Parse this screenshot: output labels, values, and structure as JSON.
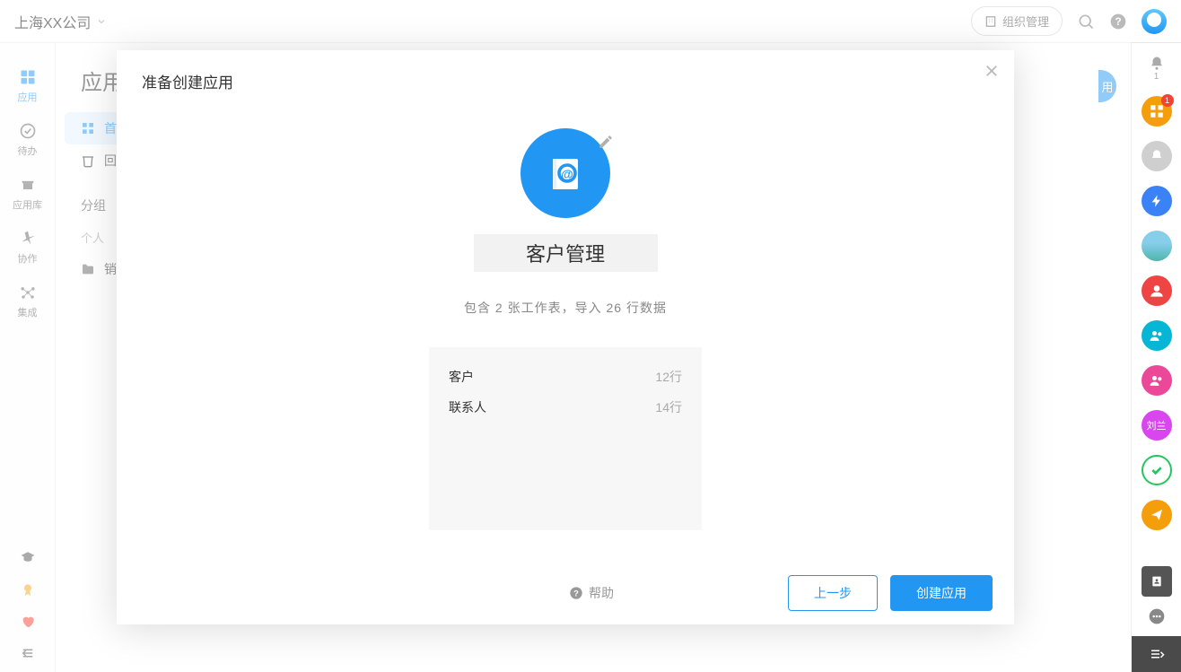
{
  "topbar": {
    "org_name": "上海XX公司",
    "org_mgmt": "组织管理"
  },
  "leftnav": {
    "items": [
      {
        "label": "应用",
        "active": true
      },
      {
        "label": "待办",
        "active": false
      },
      {
        "label": "应用库",
        "active": false
      },
      {
        "label": "协作",
        "active": false
      },
      {
        "label": "集成",
        "active": false
      }
    ]
  },
  "sidebar": {
    "title": "应用",
    "home": "首页",
    "recycle": "回收",
    "group_title": "分组",
    "personal": "个人",
    "sales": "销售"
  },
  "rightrail": {
    "bell_count": "1",
    "badge_count": "1",
    "avatar_text": "刘兰"
  },
  "create_pill": "用",
  "modal": {
    "title": "准备创建应用",
    "app_name": "客户管理",
    "summary": "包含 2 张工作表，导入 26 行数据",
    "sheets": [
      {
        "name": "客户",
        "rows": "12行"
      },
      {
        "name": "联系人",
        "rows": "14行"
      }
    ],
    "help": "帮助",
    "back": "上一步",
    "create": "创建应用"
  }
}
